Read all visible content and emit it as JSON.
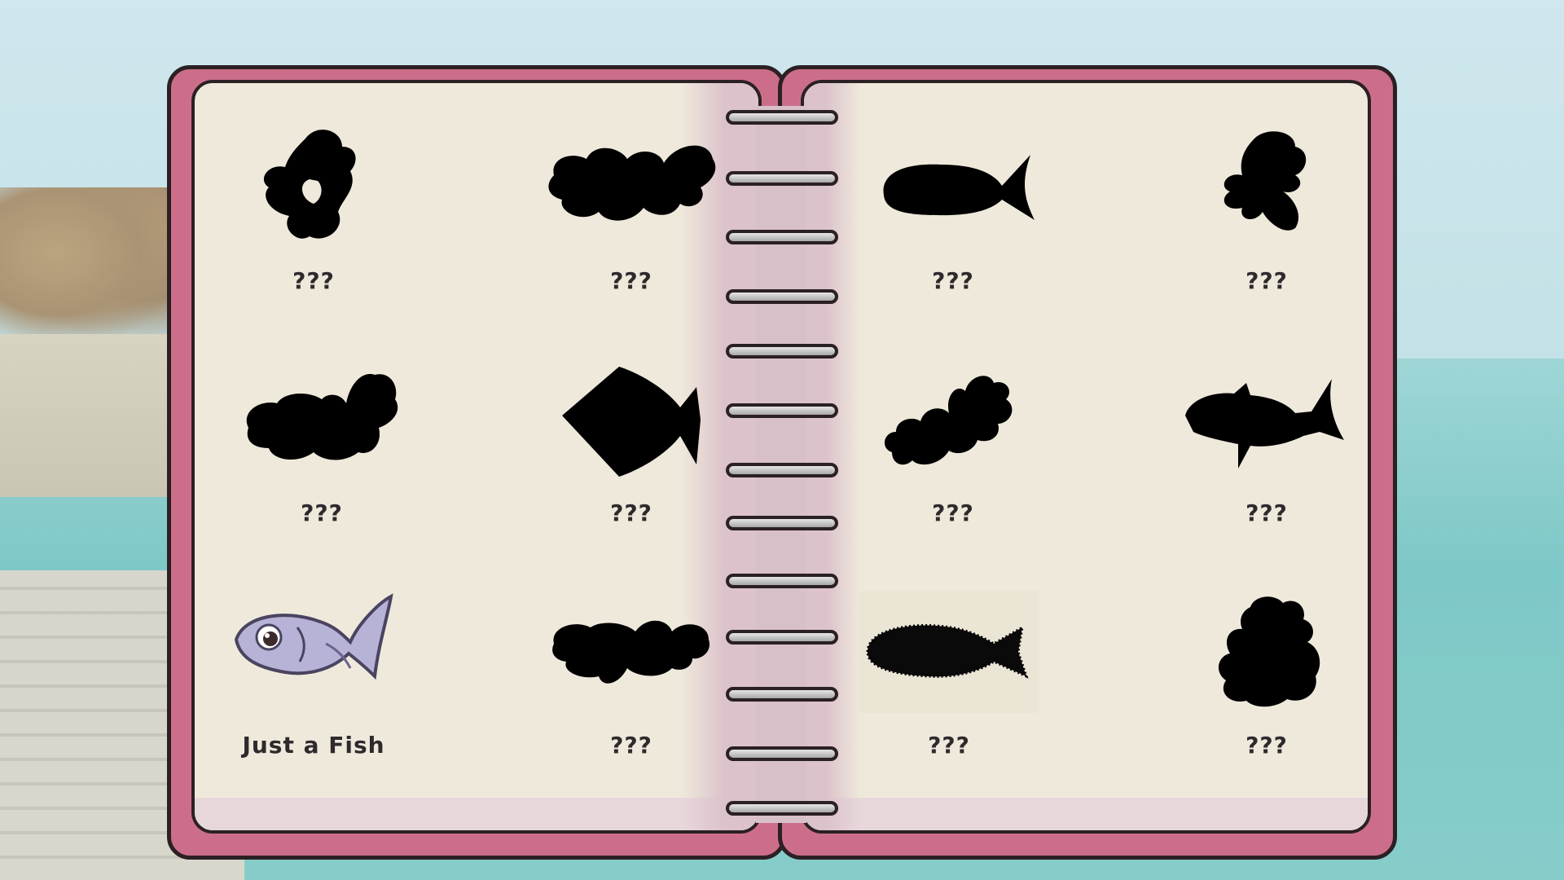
{
  "tabs": [
    {
      "name": "fish-collection-tab",
      "icon": "fish-icon",
      "color": "#a8743a"
    },
    {
      "name": "controls-tab",
      "icon": "gamepad-icon",
      "color": "#f3ea67"
    },
    {
      "name": "settings-tab",
      "icon": "gear-icon",
      "color": "#5fcf4d"
    },
    {
      "name": "exit-tab",
      "icon": "exit-door-icon",
      "color": "#e3454c"
    }
  ],
  "fish": [
    {
      "label": "???",
      "discovered": false,
      "shape": "blob-a"
    },
    {
      "label": "???",
      "discovered": false,
      "shape": "blob-b"
    },
    {
      "label": "???",
      "discovered": false,
      "shape": "oval-fish"
    },
    {
      "label": "???",
      "discovered": false,
      "shape": "blob-c"
    },
    {
      "label": "???",
      "discovered": false,
      "shape": "blob-d"
    },
    {
      "label": "???",
      "discovered": false,
      "shape": "flatfish"
    },
    {
      "label": "???",
      "discovered": false,
      "shape": "blob-e"
    },
    {
      "label": "???",
      "discovered": false,
      "shape": "spiky-fish"
    },
    {
      "label": "Just a Fish",
      "discovered": true,
      "shape": "just-a-fish"
    },
    {
      "label": "???",
      "discovered": false,
      "shape": "blob-f"
    },
    {
      "label": "???",
      "discovered": false,
      "shape": "rough-fish"
    },
    {
      "label": "???",
      "discovered": false,
      "shape": "blob-g"
    }
  ],
  "colors": {
    "silhouette": "#000000",
    "cover": "#cc6e8a",
    "page": "#efe9dc",
    "outline": "#2b2024"
  }
}
